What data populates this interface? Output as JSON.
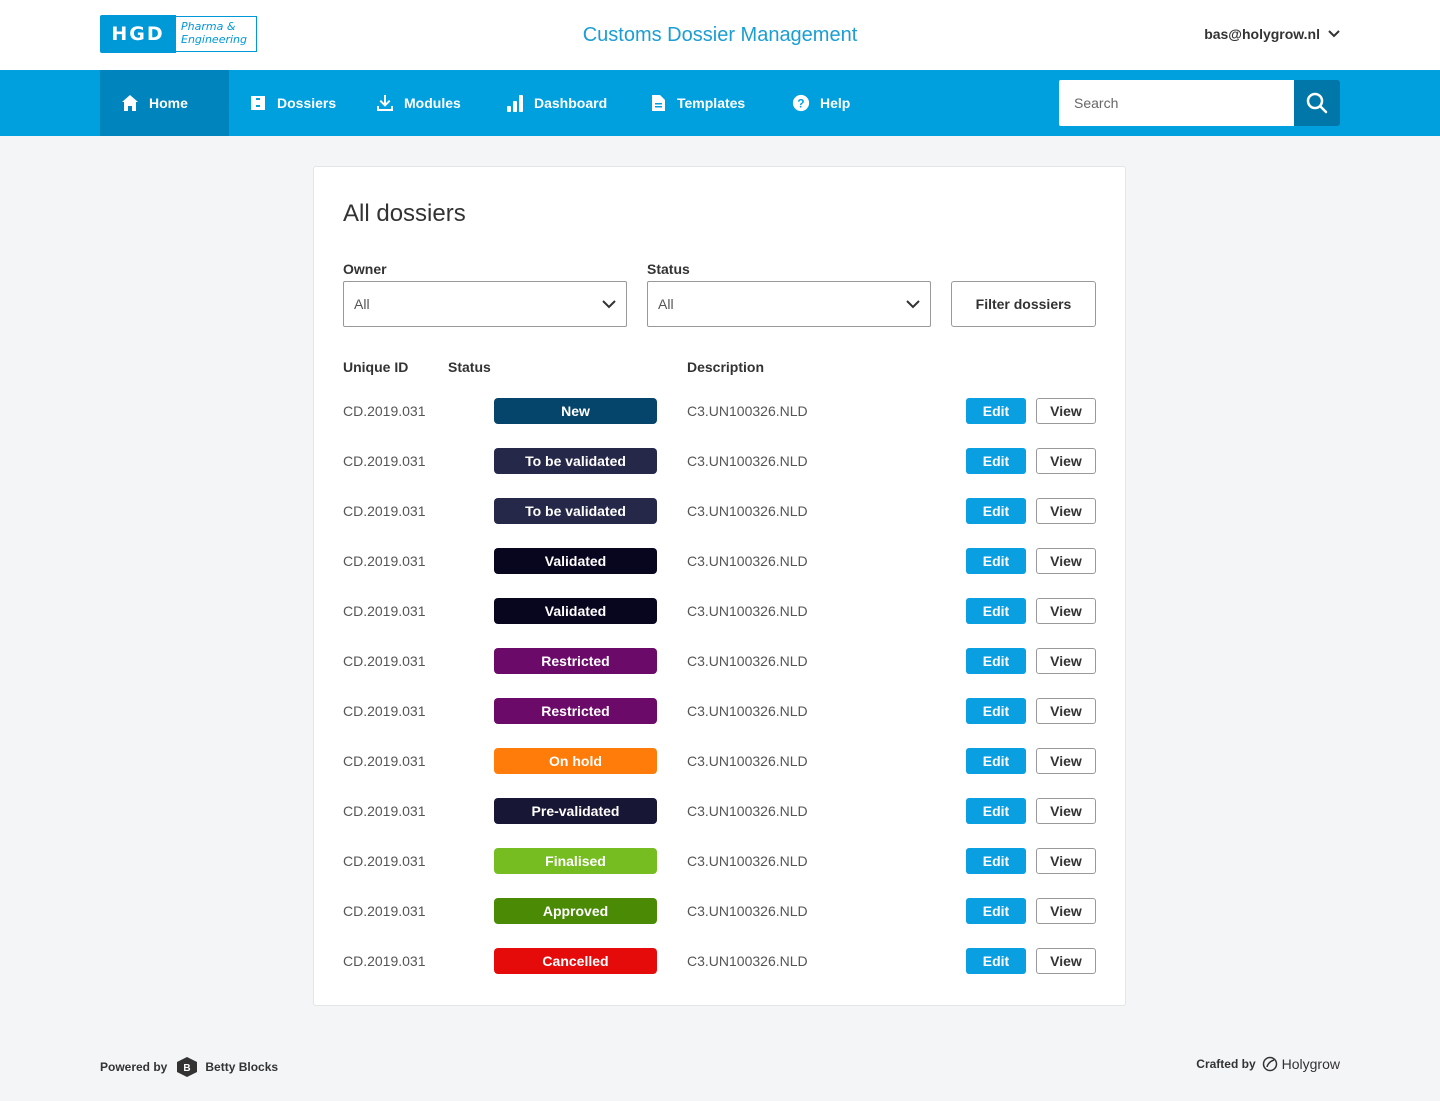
{
  "header": {
    "logo_main": "HGD",
    "logo_sub_line1": "Pharma &",
    "logo_sub_line2": "Engineering",
    "app_title": "Customs Dossier Management",
    "user_email": "bas@holygrow.nl"
  },
  "nav": {
    "items": [
      {
        "label": "Home",
        "icon": "home-icon",
        "active": true
      },
      {
        "label": "Dossiers",
        "icon": "folder-icon",
        "active": false
      },
      {
        "label": "Modules",
        "icon": "download-icon",
        "active": false
      },
      {
        "label": "Dashboard",
        "icon": "bar-chart-icon",
        "active": false
      },
      {
        "label": "Templates",
        "icon": "document-icon",
        "active": false
      },
      {
        "label": "Help",
        "icon": "help-icon",
        "active": false
      }
    ],
    "search_placeholder": "Search"
  },
  "main": {
    "title": "All dossiers",
    "filters": {
      "owner_label": "Owner",
      "owner_value": "All",
      "status_label": "Status",
      "status_value": "All",
      "filter_button": "Filter dossiers"
    },
    "columns": {
      "id": "Unique ID",
      "status": "Status",
      "description": "Description"
    },
    "edit_label": "Edit",
    "view_label": "View",
    "rows": [
      {
        "id": "CD.2019.031",
        "status": "New",
        "color": "#05456b",
        "description": "C3.UN100326.NLD"
      },
      {
        "id": "CD.2019.031",
        "status": "To be validated",
        "color": "#252848",
        "description": "C3.UN100326.NLD"
      },
      {
        "id": "CD.2019.031",
        "status": "To be validated",
        "color": "#252848",
        "description": "C3.UN100326.NLD"
      },
      {
        "id": "CD.2019.031",
        "status": "Validated",
        "color": "#08061f",
        "description": "C3.UN100326.NLD"
      },
      {
        "id": "CD.2019.031",
        "status": "Validated",
        "color": "#08061f",
        "description": "C3.UN100326.NLD"
      },
      {
        "id": "CD.2019.031",
        "status": "Restricted",
        "color": "#6c0a6a",
        "description": "C3.UN100326.NLD"
      },
      {
        "id": "CD.2019.031",
        "status": "Restricted",
        "color": "#6c0a6a",
        "description": "C3.UN100326.NLD"
      },
      {
        "id": "CD.2019.031",
        "status": "On hold",
        "color": "#ff7b0a",
        "description": "C3.UN100326.NLD"
      },
      {
        "id": "CD.2019.031",
        "status": "Pre-validated",
        "color": "#171634",
        "description": "C3.UN100326.NLD"
      },
      {
        "id": "CD.2019.031",
        "status": "Finalised",
        "color": "#76bd22",
        "description": "C3.UN100326.NLD"
      },
      {
        "id": "CD.2019.031",
        "status": "Approved",
        "color": "#4b8a05",
        "description": "C3.UN100326.NLD"
      },
      {
        "id": "CD.2019.031",
        "status": "Cancelled",
        "color": "#e60b0b",
        "description": "C3.UN100326.NLD"
      }
    ]
  },
  "footer": {
    "powered_by": "Powered by",
    "powered_brand": "Betty Blocks",
    "crafted_by": "Crafted by",
    "crafted_brand": "Holygrow"
  },
  "colors": {
    "brand": "#0099d8",
    "nav_bg": "#009fde",
    "nav_active": "#0084bd",
    "edit_button": "#0a9fe0"
  }
}
